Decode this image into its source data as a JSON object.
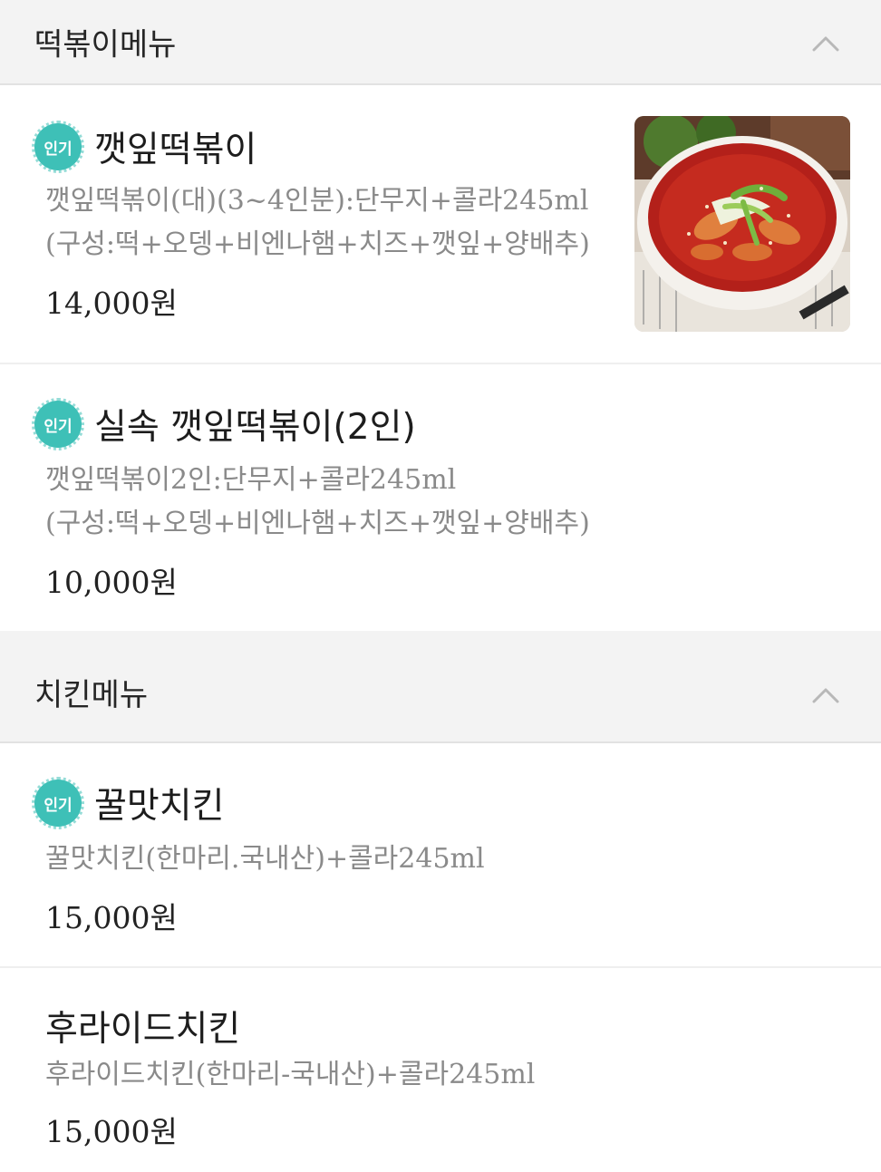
{
  "sections": [
    {
      "title": "떡볶이메뉴",
      "items": [
        {
          "badge": "인기",
          "name": "깻잎떡볶이",
          "desc_line1": "깻잎떡볶이(대)(3~4인분):단무지+콜라245ml",
          "desc_line2": "(구성:떡+오뎅+비엔나햄+치즈+깻잎+양배추)",
          "price": "14,000원"
        },
        {
          "badge": "인기",
          "name": "실속 깻잎떡볶이(2인)",
          "desc_line1": "깻잎떡볶이2인:단무지+콜라245ml",
          "desc_line2": "(구성:떡+오뎅+비엔나햄+치즈+깻잎+양배추)",
          "price": "10,000원"
        }
      ]
    },
    {
      "title": "치킨메뉴",
      "items": [
        {
          "badge": "인기",
          "name": "꿀맛치킨",
          "desc_line1": "꿀맛치킨(한마리.국내산)+콜라245ml",
          "price": "15,000원"
        },
        {
          "name": "후라이드치킨",
          "desc_line1": "후라이드치킨(한마리-국내산)+콜라245ml",
          "price": "15,000원"
        }
      ]
    }
  ],
  "colors": {
    "badge": "#3ec0b7",
    "header_bg": "#f3f3f3",
    "desc_text": "#8a8a8a"
  },
  "icons": {
    "collapse": "chevron-up-icon",
    "popular": "popular-badge"
  }
}
